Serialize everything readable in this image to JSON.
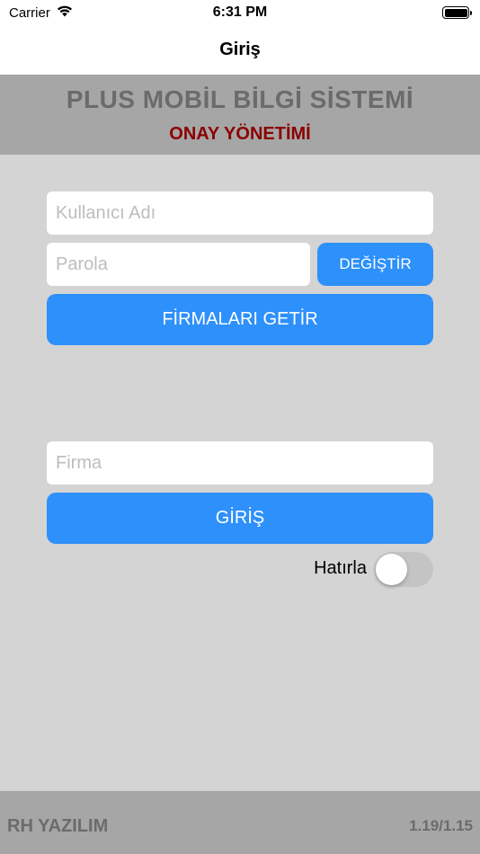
{
  "status_bar": {
    "carrier": "Carrier",
    "time": "6:31 PM"
  },
  "nav": {
    "title": "Giriş"
  },
  "header": {
    "title": "PLUS MOBİL BİLGİ SİSTEMİ",
    "subtitle": "ONAY YÖNETİMİ",
    "title_color": "#6b6b6b",
    "subtitle_color": "#8b0000"
  },
  "form": {
    "username_placeholder": "Kullanıcı Adı",
    "password_placeholder": "Parola",
    "change_label": "DEĞİŞTİR",
    "fetch_companies_label": "FİRMALARI GETİR",
    "company_placeholder": "Firma",
    "login_label": "GİRİŞ",
    "remember_label": "Hatırla",
    "remember_on": false,
    "accent_color": "#2e90fa"
  },
  "footer": {
    "company": "RH YAZILIM",
    "version": "1.19/1.15"
  }
}
